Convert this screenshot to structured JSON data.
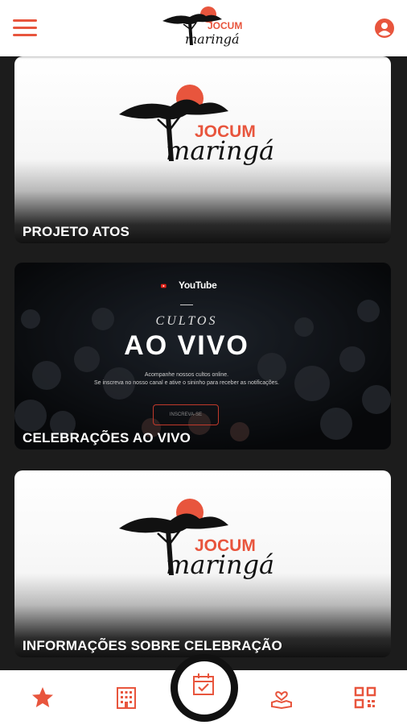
{
  "header": {
    "logo_top": "JOCUM",
    "logo_bottom": "maringá",
    "menu_icon": "hamburger-menu-icon",
    "user_icon": "account-circle-icon"
  },
  "cards": [
    {
      "title": "PROJETO ATOS",
      "logo_top": "JOCUM",
      "logo_bottom": "maringá"
    },
    {
      "title": "CELEBRAÇÕES AO VIVO",
      "youtube": "YouTube",
      "cultos": "CULTOS",
      "headline": "AO VIVO",
      "line1": "Acompanhe nossos cultos online.",
      "line2": "Se inscreva no nosso canal e ative o sininho para receber as notificações.",
      "button": "INSCREVA-SE"
    },
    {
      "title": "INFORMAÇÕES SOBRE CELEBRAÇÃO",
      "logo_top": "JOCUM",
      "logo_bottom": "maringá"
    }
  ],
  "nav": {
    "items": [
      "star-icon",
      "building-icon",
      "calendar-check-icon",
      "hand-heart-icon",
      "qr-code-icon"
    ],
    "active": "calendar-check-icon"
  },
  "colors": {
    "accent": "#e8553d",
    "background": "#1c1c1c",
    "white": "#ffffff"
  }
}
